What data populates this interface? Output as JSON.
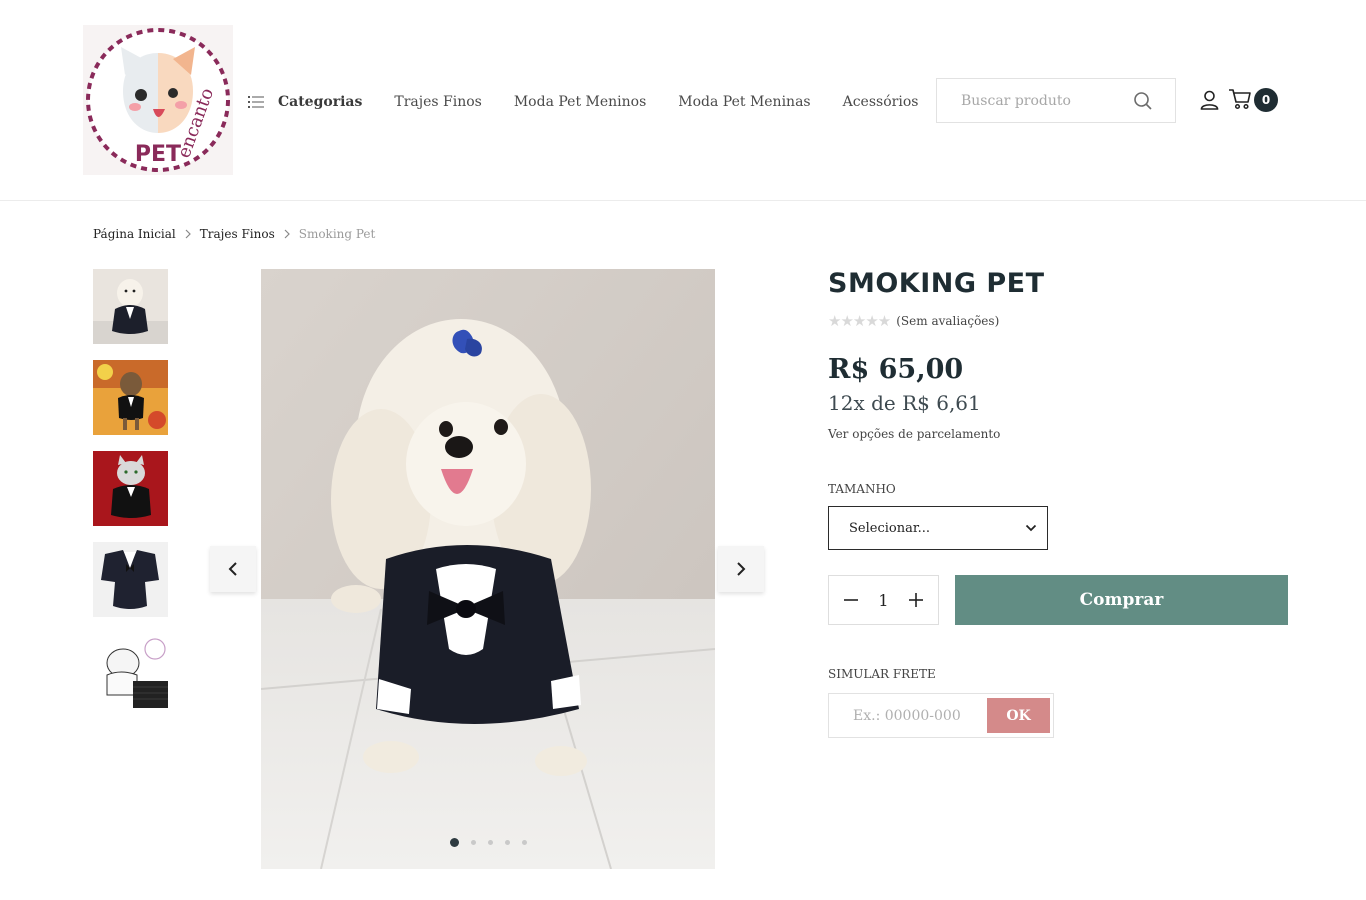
{
  "header": {
    "logo_text": "PET encanto",
    "categories_label": "Categorias",
    "nav_items": [
      "Trajes Finos",
      "Moda Pet Meninos",
      "Moda Pet Meninas",
      "Acessórios"
    ],
    "search_placeholder": "Buscar produto",
    "cart_count": "0"
  },
  "breadcrumb": [
    "Página Inicial",
    "Trajes Finos",
    "Smoking Pet"
  ],
  "gallery": {
    "thumbnails": [
      "dog-white-tuxedo",
      "yorkie-tuxedo",
      "cat-tuxedo-red",
      "tuxedo-flat",
      "size-chart"
    ],
    "active_index": 0,
    "total_images": 5
  },
  "product": {
    "title": "SMOKING PET",
    "rating_text": "(Sem avaliações)",
    "price": "R$ 65,00",
    "installments": "12x de R$ 6,61",
    "installment_link": "Ver opções de parcelamento",
    "size_label": "TAMANHO",
    "size_selected": "Selecionar...",
    "quantity": "1",
    "buy_label": "Comprar",
    "shipping_label": "SIMULAR FRETE",
    "shipping_placeholder": "Ex.: 00000-000",
    "shipping_button": "OK"
  },
  "colors": {
    "buy_button": "#628d84",
    "ok_button": "#d48a8a",
    "dark": "#1f2d33"
  }
}
